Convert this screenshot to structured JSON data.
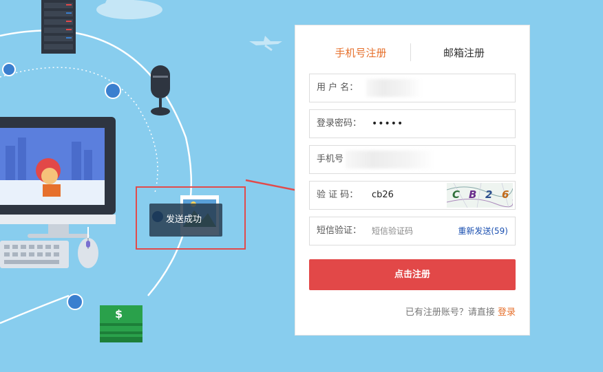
{
  "tabs": {
    "phone_label": "手机号注册",
    "email_label": "邮箱注册"
  },
  "form": {
    "username_label": "用 户 名：",
    "username_value": "",
    "password_label": "登录密码：",
    "password_value": "•••••",
    "phone_label": "手机号",
    "phone_value": "",
    "captcha_label": "验 证 码：",
    "captcha_value": "cb26",
    "captcha_image_chars": [
      "C",
      "B",
      "2",
      "6"
    ],
    "sms_label": "短信验证：",
    "sms_placeholder": "短信验证码",
    "resend_label": "重新发送(59)",
    "submit_label": "点击注册"
  },
  "footer": {
    "have_account_text": "已有注册账号？请直接",
    "login_link": "登录"
  },
  "toast": {
    "message": "发送成功"
  },
  "illustration": {
    "dollar_sign": "$"
  },
  "colors": {
    "background": "#88cdee",
    "accent": "#e6702c",
    "button": "#e24848",
    "highlight": "#e24a4a",
    "link": "#1a4fb0"
  }
}
